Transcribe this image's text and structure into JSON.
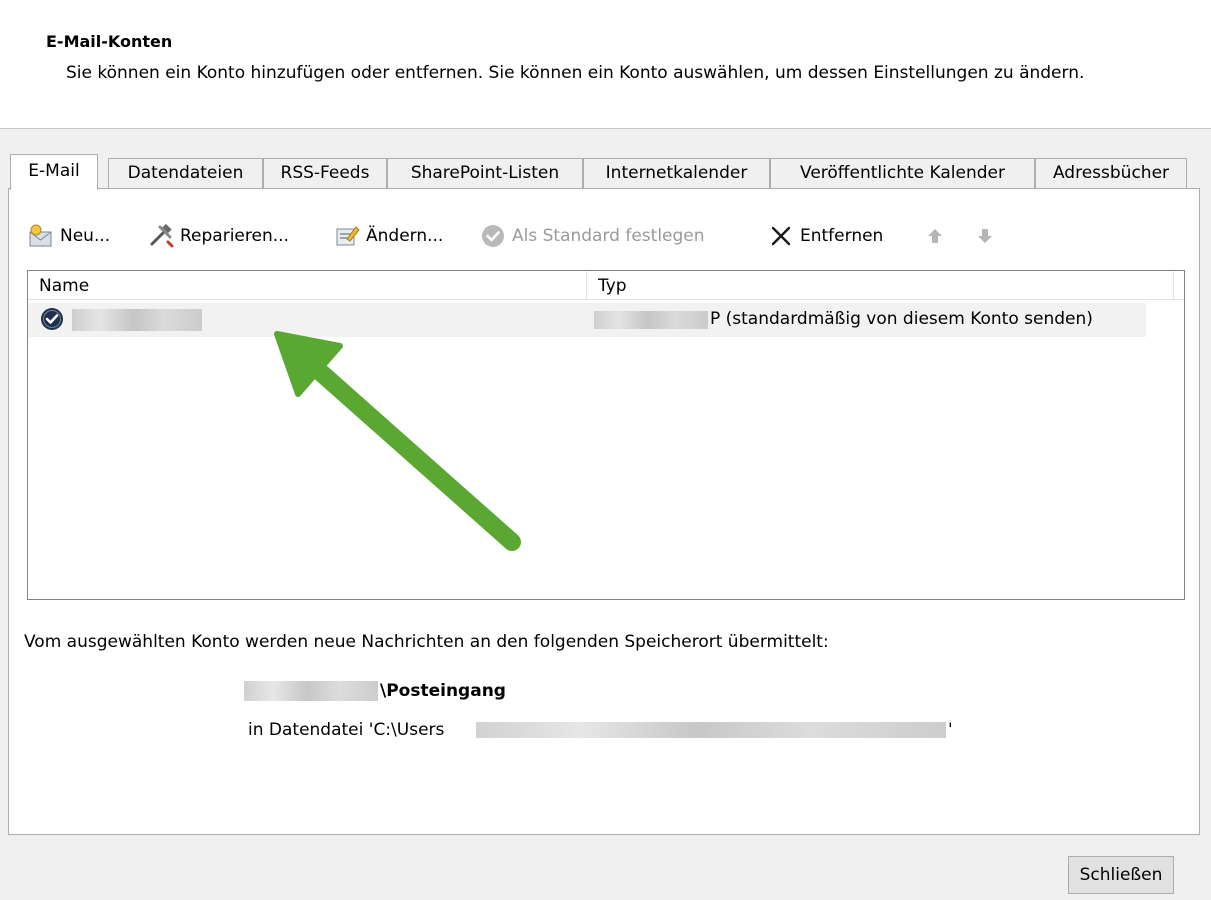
{
  "header": {
    "title": "E-Mail-Konten",
    "description": "Sie können ein Konto hinzufügen oder entfernen. Sie können ein Konto auswählen, um dessen Einstellungen zu ändern."
  },
  "tabs": [
    {
      "label": "E-Mail",
      "active": true
    },
    {
      "label": "Datendateien"
    },
    {
      "label": "RSS-Feeds"
    },
    {
      "label": "SharePoint-Listen"
    },
    {
      "label": "Internetkalender"
    },
    {
      "label": "Veröffentlichte Kalender"
    },
    {
      "label": "Adressbücher"
    }
  ],
  "toolbar": {
    "new_label": "Neu...",
    "repair_label": "Reparieren...",
    "change_label": "Ändern...",
    "default_label": "Als Standard festlegen",
    "remove_label": "Entfernen"
  },
  "list": {
    "col_name": "Name",
    "col_type": "Typ",
    "rows": [
      {
        "type_suffix": "P (standardmäßig von diesem Konto senden)"
      }
    ]
  },
  "info": {
    "text": "Vom ausgewählten Konto werden neue Nachrichten an den folgenden Speicherort übermittelt:",
    "location_name": "\\Posteingang",
    "datafile_prefix": "in Datendatei 'C:\\Users",
    "datafile_suffix": "'"
  },
  "footer": {
    "close_label": "Schließen"
  },
  "colors": {
    "arrow": "#5aa832",
    "disabled_text": "#9a9a9a"
  }
}
